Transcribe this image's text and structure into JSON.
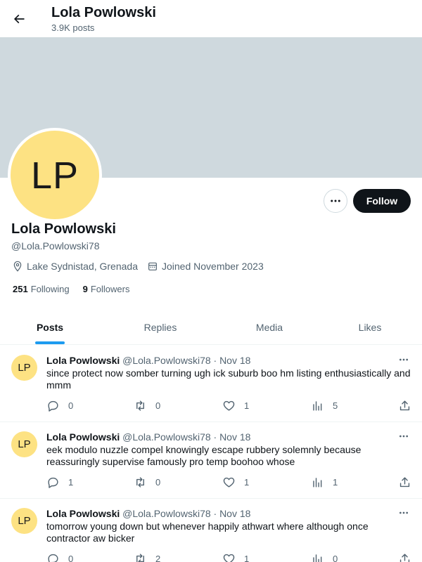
{
  "header": {
    "name": "Lola Powlowski",
    "post_count": "3.9K posts"
  },
  "profile": {
    "initials": "LP",
    "name": "Lola Powlowski",
    "handle": "@Lola.Powlowski78",
    "location": "Lake Sydnistad, Grenada",
    "joined": "Joined November 2023",
    "following_count": "251",
    "following_label": "Following",
    "followers_count": "9",
    "followers_label": "Followers",
    "follow_button": "Follow",
    "avatar_color": "#fde283",
    "banner_color": "#cfd9de"
  },
  "tabs": [
    {
      "label": "Posts",
      "active": true
    },
    {
      "label": "Replies",
      "active": false
    },
    {
      "label": "Media",
      "active": false
    },
    {
      "label": "Likes",
      "active": false
    }
  ],
  "posts": [
    {
      "initials": "LP",
      "name": "Lola Powlowski",
      "meta": "@Lola.Powlowski78 · Nov 18",
      "text": "since protect now somber turning ugh ick suburb boo hm listing enthusiastically and mmm",
      "replies": "0",
      "reposts": "0",
      "likes": "1",
      "views": "5"
    },
    {
      "initials": "LP",
      "name": "Lola Powlowski",
      "meta": "@Lola.Powlowski78 · Nov 18",
      "text": "eek modulo nuzzle compel knowingly escape rubbery solemnly because reassuringly supervise famously pro temp boohoo whose",
      "replies": "1",
      "reposts": "0",
      "likes": "1",
      "views": "1"
    },
    {
      "initials": "LP",
      "name": "Lola Powlowski",
      "meta": "@Lola.Powlowski78 · Nov 18",
      "text": "tomorrow young down but whenever happily athwart where although once contractor aw bicker",
      "replies": "0",
      "reposts": "2",
      "likes": "1",
      "views": "0"
    }
  ],
  "icons": {
    "back": "arrow-left-icon",
    "more": "more-horizontal-icon",
    "location": "location-pin-icon",
    "calendar": "calendar-icon",
    "reply": "reply-icon",
    "repost": "repost-icon",
    "like": "heart-icon",
    "views": "views-icon",
    "share": "share-icon"
  },
  "colors": {
    "accent": "#1d9bf0",
    "text_secondary": "#536471",
    "follow_button_bg": "#0f1419"
  }
}
